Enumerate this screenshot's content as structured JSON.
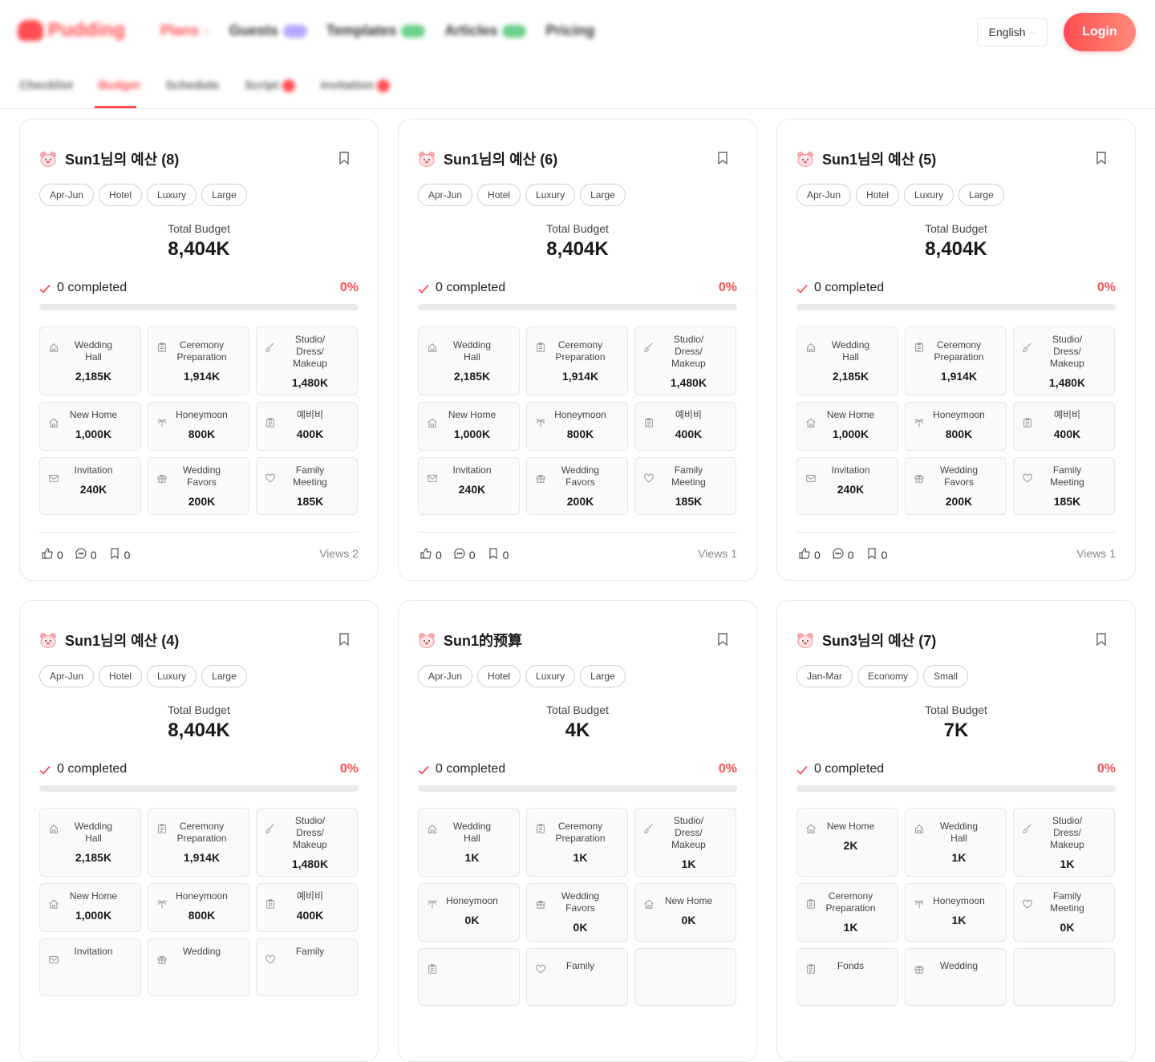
{
  "header": {
    "logo_text": "Pudding",
    "nav": [
      {
        "label": "Plans",
        "style": "red",
        "suffix": "chevron"
      },
      {
        "label": "Guests",
        "style": "",
        "suffix": "purple"
      },
      {
        "label": "Templates",
        "style": "",
        "suffix": "green"
      },
      {
        "label": "Articles",
        "style": "",
        "suffix": "green"
      },
      {
        "label": "Pricing",
        "style": "",
        "suffix": ""
      }
    ],
    "language": "English",
    "login_label": "Login"
  },
  "subnav": [
    {
      "label": "Checklist",
      "active": false,
      "badge": false
    },
    {
      "label": "Budget",
      "active": true,
      "badge": false
    },
    {
      "label": "Schedule",
      "active": false,
      "badge": false
    },
    {
      "label": "Script",
      "active": false,
      "badge": true
    },
    {
      "label": "Invitation",
      "active": false,
      "badge": true
    }
  ],
  "accent_color": "#ff4d52",
  "total_budget_label": "Total Budget",
  "completed_suffix": "completed",
  "views_label": "Views",
  "cards": [
    {
      "title": "Sun1님의 예산 (8)",
      "tags": [
        "Apr-Jun",
        "Hotel",
        "Luxury",
        "Large"
      ],
      "total": "8,404K",
      "completed": "0",
      "percent": "0%",
      "items": [
        {
          "icon": "building-icon",
          "name": [
            "Wedding",
            "Hall"
          ],
          "value": "2,185K"
        },
        {
          "icon": "clipboard-icon",
          "name": [
            "Ceremony",
            "Preparation"
          ],
          "value": "1,914K"
        },
        {
          "icon": "brush-icon",
          "name": [
            "Studio/",
            "Dress/",
            "Makeup"
          ],
          "value": "1,480K"
        },
        {
          "icon": "home-icon",
          "name": [
            "New Home"
          ],
          "value": "1,000K"
        },
        {
          "icon": "palm-icon",
          "name": [
            "Honeymoon"
          ],
          "value": "800K"
        },
        {
          "icon": "clipboard-icon",
          "name": [
            "예비비"
          ],
          "value": "400K"
        },
        {
          "icon": "envelope-icon",
          "name": [
            "Invitation"
          ],
          "value": "240K"
        },
        {
          "icon": "gift-icon",
          "name": [
            "Wedding",
            "Favors"
          ],
          "value": "200K"
        },
        {
          "icon": "heart-icon",
          "name": [
            "Family",
            "Meeting"
          ],
          "value": "185K"
        }
      ],
      "likes": "0",
      "comments": "0",
      "bookmarks": "0",
      "views": "2"
    },
    {
      "title": "Sun1님의 예산 (6)",
      "tags": [
        "Apr-Jun",
        "Hotel",
        "Luxury",
        "Large"
      ],
      "total": "8,404K",
      "completed": "0",
      "percent": "0%",
      "items": [
        {
          "icon": "building-icon",
          "name": [
            "Wedding",
            "Hall"
          ],
          "value": "2,185K"
        },
        {
          "icon": "clipboard-icon",
          "name": [
            "Ceremony",
            "Preparation"
          ],
          "value": "1,914K"
        },
        {
          "icon": "brush-icon",
          "name": [
            "Studio/",
            "Dress/",
            "Makeup"
          ],
          "value": "1,480K"
        },
        {
          "icon": "home-icon",
          "name": [
            "New Home"
          ],
          "value": "1,000K"
        },
        {
          "icon": "palm-icon",
          "name": [
            "Honeymoon"
          ],
          "value": "800K"
        },
        {
          "icon": "clipboard-icon",
          "name": [
            "예비비"
          ],
          "value": "400K"
        },
        {
          "icon": "envelope-icon",
          "name": [
            "Invitation"
          ],
          "value": "240K"
        },
        {
          "icon": "gift-icon",
          "name": [
            "Wedding",
            "Favors"
          ],
          "value": "200K"
        },
        {
          "icon": "heart-icon",
          "name": [
            "Family",
            "Meeting"
          ],
          "value": "185K"
        }
      ],
      "likes": "0",
      "comments": "0",
      "bookmarks": "0",
      "views": "1"
    },
    {
      "title": "Sun1님의 예산 (5)",
      "tags": [
        "Apr-Jun",
        "Hotel",
        "Luxury",
        "Large"
      ],
      "total": "8,404K",
      "completed": "0",
      "percent": "0%",
      "items": [
        {
          "icon": "building-icon",
          "name": [
            "Wedding",
            "Hall"
          ],
          "value": "2,185K"
        },
        {
          "icon": "clipboard-icon",
          "name": [
            "Ceremony",
            "Preparation"
          ],
          "value": "1,914K"
        },
        {
          "icon": "brush-icon",
          "name": [
            "Studio/",
            "Dress/",
            "Makeup"
          ],
          "value": "1,480K"
        },
        {
          "icon": "home-icon",
          "name": [
            "New Home"
          ],
          "value": "1,000K"
        },
        {
          "icon": "palm-icon",
          "name": [
            "Honeymoon"
          ],
          "value": "800K"
        },
        {
          "icon": "clipboard-icon",
          "name": [
            "예비비"
          ],
          "value": "400K"
        },
        {
          "icon": "envelope-icon",
          "name": [
            "Invitation"
          ],
          "value": "240K"
        },
        {
          "icon": "gift-icon",
          "name": [
            "Wedding",
            "Favors"
          ],
          "value": "200K"
        },
        {
          "icon": "heart-icon",
          "name": [
            "Family",
            "Meeting"
          ],
          "value": "185K"
        }
      ],
      "likes": "0",
      "comments": "0",
      "bookmarks": "0",
      "views": "1"
    },
    {
      "title": "Sun1님의 예산 (4)",
      "tags": [
        "Apr-Jun",
        "Hotel",
        "Luxury",
        "Large"
      ],
      "total": "8,404K",
      "completed": "0",
      "percent": "0%",
      "items": [
        {
          "icon": "building-icon",
          "name": [
            "Wedding",
            "Hall"
          ],
          "value": "2,185K"
        },
        {
          "icon": "clipboard-icon",
          "name": [
            "Ceremony",
            "Preparation"
          ],
          "value": "1,914K"
        },
        {
          "icon": "brush-icon",
          "name": [
            "Studio/",
            "Dress/",
            "Makeup"
          ],
          "value": "1,480K"
        },
        {
          "icon": "home-icon",
          "name": [
            "New Home"
          ],
          "value": "1,000K"
        },
        {
          "icon": "palm-icon",
          "name": [
            "Honeymoon"
          ],
          "value": "800K"
        },
        {
          "icon": "clipboard-icon",
          "name": [
            "예비비"
          ],
          "value": "400K"
        },
        {
          "icon": "envelope-icon",
          "name": [
            "Invitation"
          ],
          "value": ""
        },
        {
          "icon": "gift-icon",
          "name": [
            "Wedding"
          ],
          "value": ""
        },
        {
          "icon": "heart-icon",
          "name": [
            "Family"
          ],
          "value": ""
        }
      ],
      "likes": "",
      "comments": "",
      "bookmarks": "",
      "views": ""
    },
    {
      "title": "Sun1的预算",
      "tags": [
        "Apr-Jun",
        "Hotel",
        "Luxury",
        "Large"
      ],
      "total": "4K",
      "completed": "0",
      "percent": "0%",
      "items": [
        {
          "icon": "building-icon",
          "name": [
            "Wedding",
            "Hall"
          ],
          "value": "1K"
        },
        {
          "icon": "clipboard-icon",
          "name": [
            "Ceremony",
            "Preparation"
          ],
          "value": "1K"
        },
        {
          "icon": "brush-icon",
          "name": [
            "Studio/",
            "Dress/",
            "Makeup"
          ],
          "value": "1K"
        },
        {
          "icon": "palm-icon",
          "name": [
            "Honeymoon"
          ],
          "value": "0K"
        },
        {
          "icon": "gift-icon",
          "name": [
            "Wedding",
            "Favors"
          ],
          "value": "0K"
        },
        {
          "icon": "home-icon",
          "name": [
            "New Home"
          ],
          "value": "0K"
        },
        {
          "icon": "clipboard-icon",
          "name": [
            ""
          ],
          "value": ""
        },
        {
          "icon": "heart-icon",
          "name": [
            "Family"
          ],
          "value": ""
        },
        {
          "icon": "",
          "name": [
            ""
          ],
          "value": ""
        }
      ],
      "likes": "",
      "comments": "",
      "bookmarks": "",
      "views": ""
    },
    {
      "title": "Sun3님의 예산 (7)",
      "tags": [
        "Jan-Mar",
        "Economy",
        "Small"
      ],
      "total": "7K",
      "completed": "0",
      "percent": "0%",
      "items": [
        {
          "icon": "home-icon",
          "name": [
            "New Home"
          ],
          "value": "2K"
        },
        {
          "icon": "building-icon",
          "name": [
            "Wedding",
            "Hall"
          ],
          "value": "1K"
        },
        {
          "icon": "brush-icon",
          "name": [
            "Studio/",
            "Dress/",
            "Makeup"
          ],
          "value": "1K"
        },
        {
          "icon": "clipboard-icon",
          "name": [
            "Ceremony",
            "Preparation"
          ],
          "value": "1K"
        },
        {
          "icon": "palm-icon",
          "name": [
            "Honeymoon"
          ],
          "value": "1K"
        },
        {
          "icon": "heart-icon",
          "name": [
            "Family",
            "Meeting"
          ],
          "value": "0K"
        },
        {
          "icon": "clipboard-icon",
          "name": [
            "Fonds"
          ],
          "value": ""
        },
        {
          "icon": "gift-icon",
          "name": [
            "Wedding"
          ],
          "value": ""
        },
        {
          "icon": "",
          "name": [
            ""
          ],
          "value": ""
        }
      ],
      "likes": "",
      "comments": "",
      "bookmarks": "",
      "views": ""
    }
  ]
}
